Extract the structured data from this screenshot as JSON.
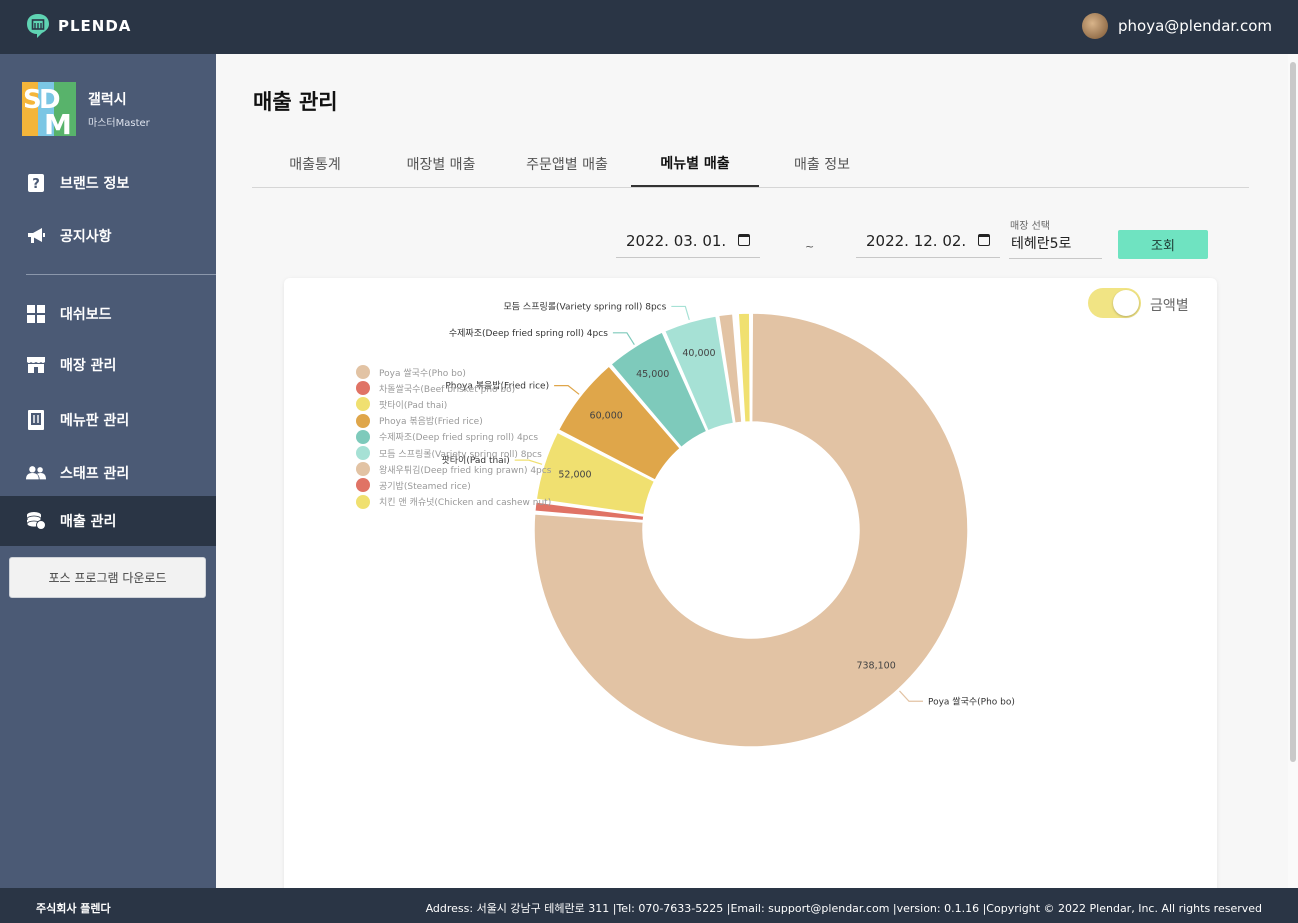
{
  "app": {
    "brand_name": "PLENDA"
  },
  "header": {
    "user_email": "phoya@plendar.com"
  },
  "sidebar": {
    "brand": {
      "name": "갤럭시",
      "role": "마스터Master",
      "logo_text": "SDM"
    },
    "items": [
      {
        "label": "브랜드 정보",
        "icon": "question-icon"
      },
      {
        "label": "공지사항",
        "icon": "megaphone-icon"
      },
      {
        "label": "대쉬보드",
        "icon": "grid-icon"
      },
      {
        "label": "매장 관리",
        "icon": "store-icon"
      },
      {
        "label": "메뉴판 관리",
        "icon": "menu-board-icon"
      },
      {
        "label": "스태프 관리",
        "icon": "users-icon"
      },
      {
        "label": "매출 관리",
        "icon": "coins-icon",
        "active": true
      }
    ],
    "download_label": "포스 프로그램 다운로드"
  },
  "main": {
    "title": "매출 관리",
    "tabs": [
      {
        "label": "매출통계"
      },
      {
        "label": "매장별 매출"
      },
      {
        "label": "주문앱별 매출"
      },
      {
        "label": "메뉴별 매출",
        "active": true
      },
      {
        "label": "매출 정보"
      }
    ],
    "filters": {
      "start_date": "2022. 03. 01.",
      "separator": "~",
      "end_date": "2022. 12. 02.",
      "store_label": "매장 선택",
      "store_value": "테헤란5로",
      "search_label": "조회"
    },
    "toggle": {
      "label": "금액별",
      "on": true
    }
  },
  "chart_data": {
    "type": "pie",
    "donut": true,
    "legend_position": "top-left",
    "series": [
      {
        "name": "Poya 쌀국수(Pho bo)",
        "value": 738100,
        "color": "#e2c3a4",
        "value_label": "738,100",
        "callout": "Poya 쌀국수(Pho bo)"
      },
      {
        "name": "차돌쌀국수(Beef brisket pho bo)",
        "value": 8500,
        "color": "#e07365",
        "value_label": "",
        "callout": ""
      },
      {
        "name": "팟타이(Pad thai)",
        "value": 52000,
        "color": "#f0e070",
        "value_label": "52,000",
        "callout": "팟타이(Pad thai)"
      },
      {
        "name": "Phoya 볶음밥(Fried rice)",
        "value": 60000,
        "color": "#dfa64a",
        "value_label": "60,000",
        "callout": "Phoya 볶음밥(Fried rice)"
      },
      {
        "name": "수제짜조(Deep fried spring roll) 4pcs",
        "value": 45000,
        "color": "#7ecabb",
        "value_label": "45,000",
        "callout": "수제짜조(Deep fried spring roll) 4pcs"
      },
      {
        "name": "모듬 스프링롤(Variety spring roll) 8pcs",
        "value": 40000,
        "color": "#a6e1d5",
        "value_label": "40,000",
        "callout": "모듬 스프링롤(Variety spring roll) 8pcs"
      },
      {
        "name": "왕새우튀김(Deep fried king prawn) 4pcs",
        "value": 12000,
        "color": "#e2c3a4",
        "value_label": "",
        "callout": ""
      },
      {
        "name": "공기밥(Steamed rice)",
        "value": 2000,
        "color": "#e07365",
        "value_label": "",
        "callout": ""
      },
      {
        "name": "치킨 앤 캐슈넛(Chicken and cashew nut)",
        "value": 10000,
        "color": "#f0e070",
        "value_label": "",
        "callout": ""
      }
    ]
  },
  "footer": {
    "company": "주식회사 플렌다",
    "info": "Address: 서울시 강남구 테헤란로 311 |Tel: 070-7633-5225 |Email: support@plendar.com |version: 0.1.16 |Copyright © 2022 Plendar, Inc. All rights reserved"
  }
}
